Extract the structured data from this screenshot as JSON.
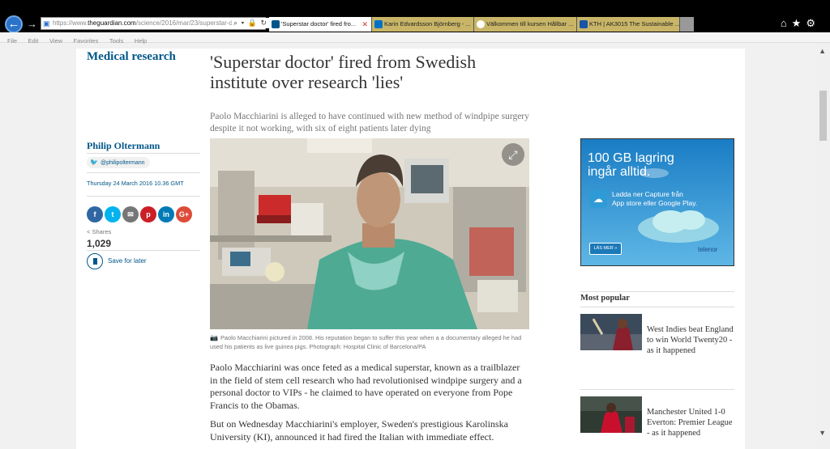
{
  "browser": {
    "url_prefix": "https://www.",
    "url_host": "theguardian.com",
    "url_path": "/science/2016/mar/23/superstar-d",
    "address_icons": "⌕ ▾ 🔒 ↻",
    "tabs": [
      {
        "label": "'Superstar doctor' fired fro...",
        "active": true,
        "icon_color": "#005689"
      },
      {
        "label": "Karin Edvardsson Björnberg - ...",
        "active": false,
        "icon_color": "#0072c6"
      },
      {
        "label": "Välkommen till kursen Hållbar ...",
        "active": false,
        "icon_color": "#ffffff"
      },
      {
        "label": "KTH | AK3015 The Sustainable ...",
        "active": false,
        "icon_color": "#1954a6"
      }
    ],
    "tab_close": "✕",
    "menu": [
      "File",
      "Edit",
      "View",
      "Favorites",
      "Tools",
      "Help"
    ],
    "right_icons": "⌂★⚙"
  },
  "article": {
    "section": "Medical research",
    "headline": "'Superstar doctor' fired from Swedish institute over research 'lies'",
    "standfirst": "Paolo Macchiarini is alleged to have continued with new method of windpipe surgery despite it not working, with six of eight patients later dying",
    "author": "Philip Oltermann",
    "twitter": "@philipoltermann",
    "date": "Thursday 24 March 2016 10.36 GMT",
    "share_buttons": [
      {
        "name": "facebook",
        "glyph": "f",
        "color": "#3067a3"
      },
      {
        "name": "twitter",
        "glyph": "t",
        "color": "#03b3ee"
      },
      {
        "name": "email",
        "glyph": "✉",
        "color": "#767676"
      },
      {
        "name": "pinterest",
        "glyph": "p",
        "color": "#cb1f27"
      },
      {
        "name": "linkedin",
        "glyph": "in",
        "color": "#007bb6"
      },
      {
        "name": "googleplus",
        "glyph": "G+",
        "color": "#dd4b39"
      }
    ],
    "shares_label": "Shares",
    "shares_count": "1,029",
    "save_label": "Save for later",
    "caption": "Paolo Macchiarini pictured in 2008. His reputation began to suffer this year when a a documentary alleged he had used his patients as live guinea pigs. Photograph: Hospital Clinic of Barcelona/PA",
    "paragraphs": [
      "Paolo Macchiarini was once feted as a medical superstar, known as a trailblazer in the field of stem cell research who had revolutionised windpipe surgery and a personal doctor to VIPs - he claimed to have operated on everyone from Pope Francis to the Obamas.",
      "But on Wednesday Macchiarini's employer, Sweden's prestigious Karolinska University (KI), announced it had fired the Italian with immediate effect."
    ]
  },
  "ad": {
    "headline_1": "100 GB lagring",
    "headline_2": "ingår alltid.",
    "text_1": "Ladda ner Capture från",
    "text_2": "App store eller Google Play.",
    "cta": "LÄS MER »",
    "brand": "telenor"
  },
  "most_popular": {
    "title": "Most popular",
    "items": [
      {
        "title": "West Indies beat England to win World Twenty20 - as it happened"
      },
      {
        "title": "Manchester United 1-0 Everton: Premier League - as it happened"
      }
    ]
  },
  "colors": {
    "guardian_blue": "#005689",
    "ad_blue": "#1b79b8"
  }
}
